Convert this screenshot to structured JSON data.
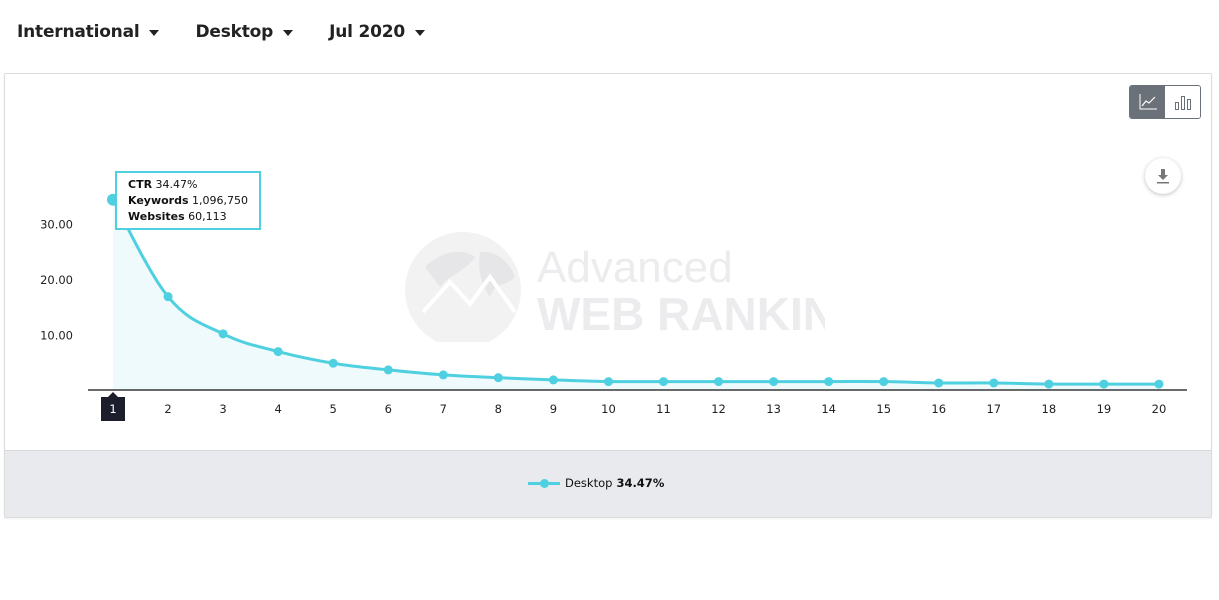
{
  "filters": [
    {
      "label": "International"
    },
    {
      "label": "Desktop"
    },
    {
      "label": "Jul 2020"
    }
  ],
  "toggle": {
    "line_icon": "line-chart-icon",
    "bar_icon": "bar-chart-icon",
    "active": "line"
  },
  "download": {
    "icon": "download-icon"
  },
  "watermark": {
    "line1": "Advanced",
    "line2": "WEB RANKING"
  },
  "tooltip": {
    "ctr_label": "CTR",
    "ctr_value": "34.47%",
    "keywords_label": "Keywords",
    "keywords_value": "1,096,750",
    "websites_label": "Websites",
    "websites_value": "60,113"
  },
  "legend": {
    "series_name": "Desktop",
    "series_value": "34.47%"
  },
  "colors": {
    "series": "#4fd0e0",
    "area_fill": "#ecf9fb",
    "axis": "#111111",
    "active_tick_bg": "#1c1f2b"
  },
  "chart_data": {
    "type": "area",
    "title": "",
    "xlabel": "",
    "ylabel": "",
    "x": [
      1,
      2,
      3,
      4,
      5,
      6,
      7,
      8,
      9,
      10,
      11,
      12,
      13,
      14,
      15,
      16,
      17,
      18,
      19,
      20
    ],
    "categories": [
      "1",
      "2",
      "3",
      "4",
      "5",
      "6",
      "7",
      "8",
      "9",
      "10",
      "11",
      "12",
      "13",
      "14",
      "15",
      "16",
      "17",
      "18",
      "19",
      "20"
    ],
    "series": [
      {
        "name": "Desktop",
        "values": [
          34.47,
          17.0,
          10.3,
          7.1,
          5.0,
          3.8,
          2.9,
          2.4,
          2.0,
          1.7,
          1.7,
          1.7,
          1.7,
          1.7,
          1.7,
          1.45,
          1.45,
          1.25,
          1.25,
          1.25
        ]
      }
    ],
    "yticks": [
      "10.00",
      "20.00",
      "30.00"
    ],
    "ytick_values": [
      10,
      20,
      30
    ],
    "ylim": [
      0,
      35
    ],
    "grid": false,
    "active_x": 1,
    "legend_position": "bottom-center"
  }
}
